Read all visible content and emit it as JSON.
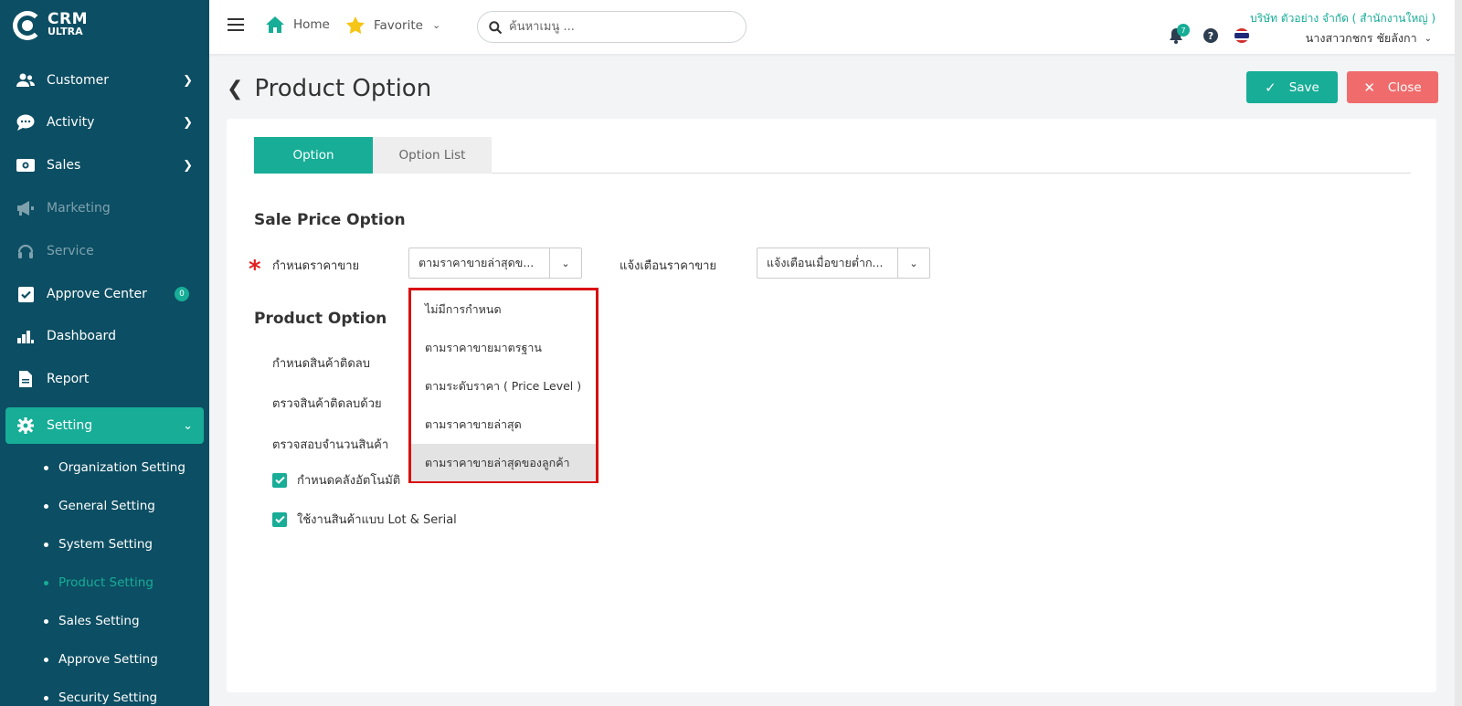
{
  "app": {
    "logo_line1": "CRM",
    "logo_line2": "ULTRA"
  },
  "sidebar": {
    "items": [
      {
        "label": "Customer",
        "icon": "users-icon"
      },
      {
        "label": "Activity",
        "icon": "chat-icon"
      },
      {
        "label": "Sales",
        "icon": "money-icon"
      },
      {
        "label": "Marketing",
        "icon": "megaphone-icon"
      },
      {
        "label": "Service",
        "icon": "headset-icon"
      },
      {
        "label": "Approve Center",
        "icon": "check-square-icon",
        "badge": "0"
      },
      {
        "label": "Dashboard",
        "icon": "bar-chart-icon"
      },
      {
        "label": "Report",
        "icon": "file-icon"
      },
      {
        "label": "Setting",
        "icon": "gear-icon"
      }
    ],
    "sub_items": [
      "Organization Setting",
      "General Setting",
      "System Setting",
      "Product Setting",
      "Sales Setting",
      "Approve Setting",
      "Security Setting"
    ],
    "active_sub": "Product Setting"
  },
  "topbar": {
    "home_label": "Home",
    "favorite_label": "Favorite",
    "search_placeholder": "ค้นหาเมนู ...",
    "company": "บริษัท ตัวอย่าง จำกัด ( สำนักงานใหญ่ )",
    "notification_count": "7",
    "user_name": "นางสาวกชกร ชัยลังกา"
  },
  "page": {
    "title": "Product Option",
    "save_label": "Save",
    "close_label": "Close"
  },
  "tabs": [
    "Option",
    "Option List"
  ],
  "sale_price": {
    "section_title": "Sale Price Option",
    "price_label": "กำหนดราคาขาย",
    "price_value": "ตามราคาขายล่าสุดข...",
    "alert_label": "แจ้งเตือนราคาขาย",
    "alert_value": "แจ้งเตือนเมื่อขายต่ำก..."
  },
  "dropdown_options": [
    "ไม่มีการกำหนด",
    "ตามราคาขายมาตรฐาน",
    "ตามระดับราคา ( Price Level )",
    "ตามราคาขายล่าสุด",
    "ตามราคาขายล่าสุดของลูกค้า"
  ],
  "product_option": {
    "section_title": "Product Option",
    "labels": [
      "กำหนดสินค้าติดลบ",
      "ตรวจสินค้าติดลบด้วย",
      "ตรวจสอบจำนวนสินค้า"
    ],
    "checkboxes": [
      {
        "label": "กำหนดคลังอัตโนมัติ",
        "checked": true
      },
      {
        "label": "ใช้งานสินค้าแบบ Lot & Serial",
        "checked": true
      }
    ]
  },
  "colors": {
    "sidebar": "#0c4e63",
    "accent": "#17ad97",
    "danger": "#f06c6c",
    "highlight_border": "#d90f0f"
  }
}
